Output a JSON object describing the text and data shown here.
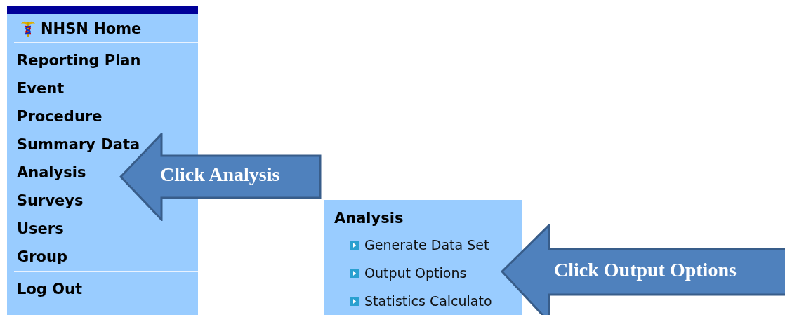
{
  "sidebar": {
    "home": "NHSN Home",
    "items": [
      {
        "label": "Reporting Plan"
      },
      {
        "label": "Event"
      },
      {
        "label": "Procedure"
      },
      {
        "label": "Summary Data"
      },
      {
        "label": "Analysis"
      },
      {
        "label": "Surveys"
      },
      {
        "label": "Users"
      },
      {
        "label": "Group"
      }
    ],
    "logout": "Log Out"
  },
  "submenu": {
    "title": "Analysis",
    "items": [
      {
        "label": "Generate Data Set"
      },
      {
        "label": "Output Options"
      },
      {
        "label": "Statistics Calculato"
      }
    ]
  },
  "callouts": [
    {
      "text": "Click Analysis"
    },
    {
      "text": "Click Output Options"
    }
  ]
}
